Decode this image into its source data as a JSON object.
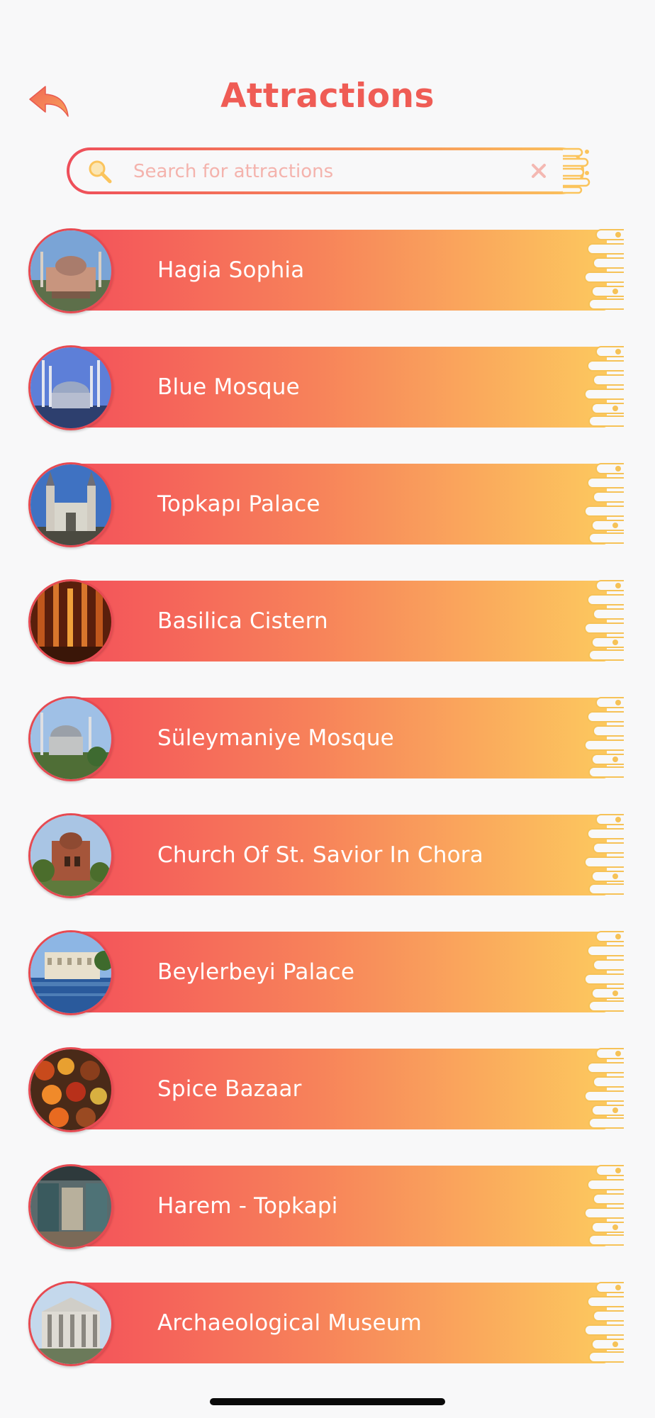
{
  "header": {
    "title": "Attractions",
    "back_icon": "back-arrow-icon"
  },
  "search": {
    "placeholder": "Search for attractions",
    "value": "",
    "search_icon": "search-icon",
    "clear_icon": "close-icon"
  },
  "colors": {
    "accent_red": "#ef5c55",
    "gradient_start": "#f4525a",
    "gradient_end": "#fcc85e",
    "background": "#f8f8f9",
    "label": "#ffffff"
  },
  "attractions": [
    {
      "label": "Hagia Sophia"
    },
    {
      "label": "Blue Mosque"
    },
    {
      "label": "Topkapı Palace"
    },
    {
      "label": "Basilica Cistern"
    },
    {
      "label": "Süleymaniye Mosque"
    },
    {
      "label": "Church Of St. Savior In Chora"
    },
    {
      "label": "Beylerbeyi Palace"
    },
    {
      "label": "Spice Bazaar"
    },
    {
      "label": "Harem - Topkapi"
    },
    {
      "label": "Archaeological Museum"
    }
  ]
}
